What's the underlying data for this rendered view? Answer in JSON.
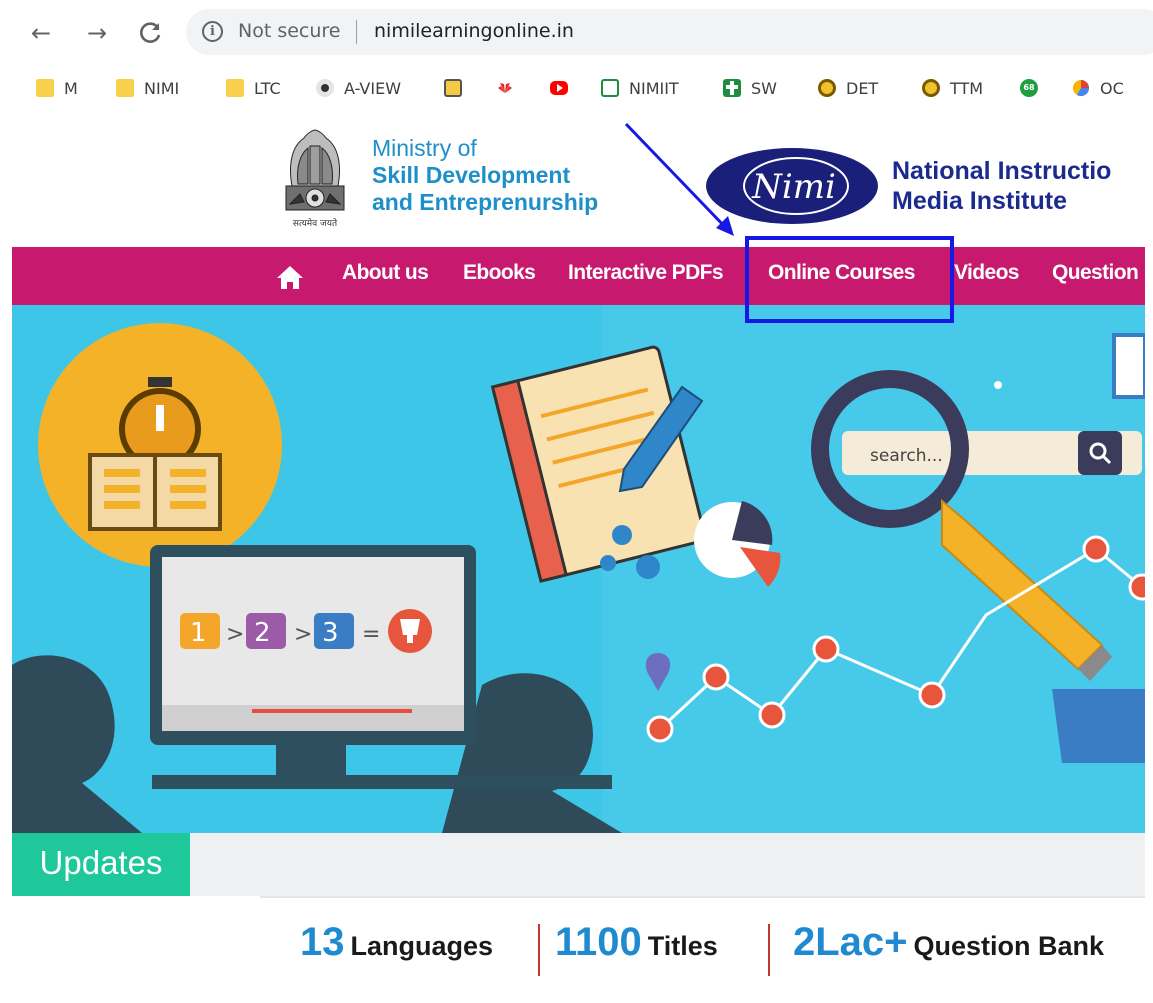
{
  "browser": {
    "back_icon": "←",
    "forward_icon": "→",
    "reload_icon": "C",
    "security_label": "Not secure",
    "url": "nimilearningonline.in",
    "bookmarks": [
      {
        "label": "M",
        "icon": "folder-icon"
      },
      {
        "label": "NIMI",
        "icon": "folder-icon"
      },
      {
        "label": "LTC",
        "icon": "folder-icon"
      },
      {
        "label": "A-VIEW",
        "icon": "webcam-icon"
      },
      {
        "label": "",
        "icon": "flag-icon"
      },
      {
        "label": "",
        "icon": "huawei-icon"
      },
      {
        "label": "",
        "icon": "youtube-icon"
      },
      {
        "label": "NIMIIT",
        "icon": "sheets-icon"
      },
      {
        "label": "SW",
        "icon": "cross-icon"
      },
      {
        "label": "DET",
        "icon": "emblem-icon"
      },
      {
        "label": "TTM",
        "icon": "emblem-icon"
      },
      {
        "label": "",
        "icon": "badge-68-icon"
      },
      {
        "label": "OC",
        "icon": "pie-icon"
      }
    ],
    "badge_count": "68"
  },
  "header": {
    "emblem_caption": "सत्यमेव जयते",
    "ministry_line1": "Ministry of",
    "ministry_line2": "Skill Development",
    "ministry_line3": "and Entreprenurship",
    "nimi_logo_text": "Nimi",
    "nimi_line1": "National Instructio",
    "nimi_line2": "Media Institute"
  },
  "nav": {
    "items": [
      {
        "label": "About us"
      },
      {
        "label": "Ebooks"
      },
      {
        "label": "Interactive PDFs"
      },
      {
        "label": "Online Courses"
      },
      {
        "label": "Videos"
      },
      {
        "label": "Question"
      }
    ]
  },
  "hero": {
    "search_placeholder": "search...",
    "steps": [
      "1",
      "2",
      "3"
    ],
    "operators": [
      ">",
      ">",
      "="
    ]
  },
  "updates": {
    "tab_label": "Updates"
  },
  "stats": [
    {
      "number": "13",
      "label": "Languages"
    },
    {
      "number": "1100",
      "label": "Titles"
    },
    {
      "number": "2Lac+",
      "label": "Question Bank"
    }
  ],
  "colors": {
    "nav_bg": "#c71a6e",
    "hero_bg": "#3dc6e8",
    "updates_green": "#1ec89a",
    "stat_blue": "#1f8ad0",
    "annotation_blue": "#1717e6"
  }
}
